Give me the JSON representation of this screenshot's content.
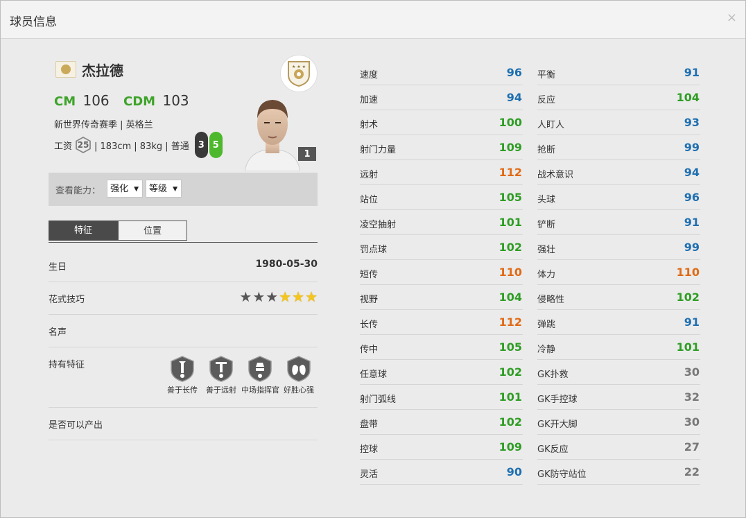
{
  "window": {
    "title": "球员信息",
    "close": "×"
  },
  "player": {
    "name": "杰拉德",
    "positions": [
      {
        "code": "CM",
        "ovr": "106"
      },
      {
        "code": "CDM",
        "ovr": "103"
      }
    ],
    "season_nation": "新世界传奇赛季 | 英格兰",
    "wage_label": "工资",
    "wage": "25",
    "physical": "| 183cm | 83kg | 普通",
    "weak_foot": "3",
    "strong_foot": "5",
    "rank": "1"
  },
  "ability": {
    "label": "查看能力：",
    "select_upgrade": "强化",
    "select_level": "等级"
  },
  "tabs": [
    {
      "label": "特征",
      "active": true
    },
    {
      "label": "位置",
      "active": false
    }
  ],
  "info": {
    "birthday_label": "生日",
    "birthday": "1980-05-30",
    "skill_label": "花式技巧",
    "skill_stars": 3,
    "skill_max": 6,
    "fame_label": "名声",
    "traits_label": "持有特征",
    "traits": [
      {
        "label": "善于长传",
        "icon": "long-pass-icon"
      },
      {
        "label": "善于远射",
        "icon": "long-shot-icon"
      },
      {
        "label": "中场指挥官",
        "icon": "playmaker-icon"
      },
      {
        "label": "好胜心强",
        "icon": "lungs-icon"
      }
    ],
    "producible_label": "是否可以产出"
  },
  "stats_left": [
    {
      "name": "速度",
      "value": "96",
      "color": "#1f6fb0"
    },
    {
      "name": "加速",
      "value": "94",
      "color": "#1f6fb0"
    },
    {
      "name": "射术",
      "value": "100",
      "color": "#2f9d25"
    },
    {
      "name": "射门力量",
      "value": "109",
      "color": "#2f9d25"
    },
    {
      "name": "远射",
      "value": "112",
      "color": "#e06a15"
    },
    {
      "name": "站位",
      "value": "105",
      "color": "#2f9d25"
    },
    {
      "name": "凌空抽射",
      "value": "101",
      "color": "#2f9d25"
    },
    {
      "name": "罚点球",
      "value": "102",
      "color": "#2f9d25"
    },
    {
      "name": "短传",
      "value": "110",
      "color": "#e06a15"
    },
    {
      "name": "视野",
      "value": "104",
      "color": "#2f9d25"
    },
    {
      "name": "长传",
      "value": "112",
      "color": "#e06a15"
    },
    {
      "name": "传中",
      "value": "105",
      "color": "#2f9d25"
    },
    {
      "name": "任意球",
      "value": "102",
      "color": "#2f9d25"
    },
    {
      "name": "射门弧线",
      "value": "101",
      "color": "#2f9d25"
    },
    {
      "name": "盘带",
      "value": "102",
      "color": "#2f9d25"
    },
    {
      "name": "控球",
      "value": "109",
      "color": "#2f9d25"
    },
    {
      "name": "灵活",
      "value": "90",
      "color": "#1f6fb0"
    }
  ],
  "stats_right": [
    {
      "name": "平衡",
      "value": "91",
      "color": "#1f6fb0"
    },
    {
      "name": "反应",
      "value": "104",
      "color": "#2f9d25"
    },
    {
      "name": "人盯人",
      "value": "93",
      "color": "#1f6fb0"
    },
    {
      "name": "抢断",
      "value": "99",
      "color": "#1f6fb0"
    },
    {
      "name": "战术意识",
      "value": "94",
      "color": "#1f6fb0"
    },
    {
      "name": "头球",
      "value": "96",
      "color": "#1f6fb0"
    },
    {
      "name": "铲断",
      "value": "91",
      "color": "#1f6fb0"
    },
    {
      "name": "强壮",
      "value": "99",
      "color": "#1f6fb0"
    },
    {
      "name": "体力",
      "value": "110",
      "color": "#e06a15"
    },
    {
      "name": "侵略性",
      "value": "102",
      "color": "#2f9d25"
    },
    {
      "name": "弹跳",
      "value": "91",
      "color": "#1f6fb0"
    },
    {
      "name": "冷静",
      "value": "101",
      "color": "#2f9d25"
    },
    {
      "name": "GK扑救",
      "value": "30",
      "color": "#777777"
    },
    {
      "name": "GK手控球",
      "value": "32",
      "color": "#777777"
    },
    {
      "name": "GK开大脚",
      "value": "30",
      "color": "#777777"
    },
    {
      "name": "GK反应",
      "value": "27",
      "color": "#777777"
    },
    {
      "name": "GK防守站位",
      "value": "22",
      "color": "#777777"
    }
  ]
}
